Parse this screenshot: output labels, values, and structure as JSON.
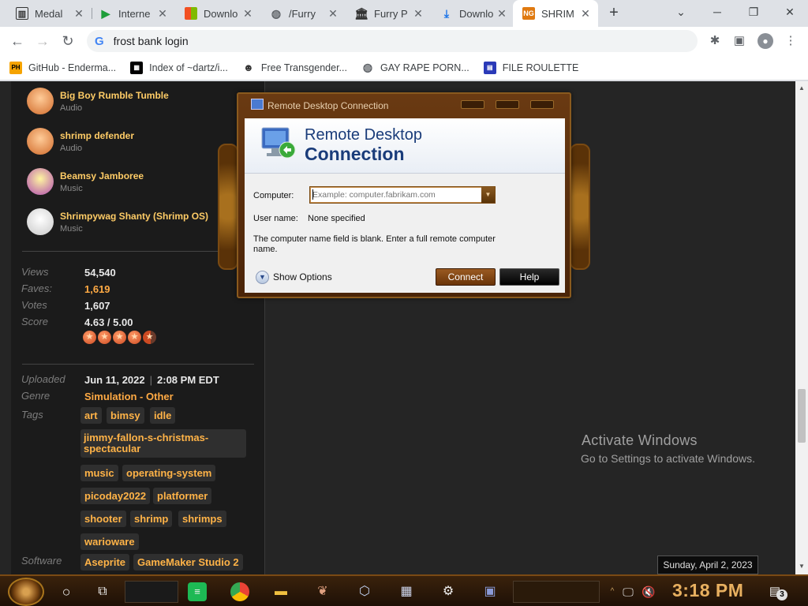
{
  "tabs": [
    {
      "title": "Medal",
      "icon": "medal-icon"
    },
    {
      "title": "Interne",
      "icon": "play-icon"
    },
    {
      "title": "Downlo",
      "icon": "windows-icon"
    },
    {
      "title": "/Furry",
      "icon": "globe-icon"
    },
    {
      "title": "Furry P",
      "icon": "archive-icon"
    },
    {
      "title": "Downlo",
      "icon": "download-icon"
    },
    {
      "title": "SHRIM",
      "icon": "newgrounds-icon"
    }
  ],
  "address_bar": {
    "value": "frost bank login"
  },
  "bookmarks": [
    {
      "label": "GitHub - Enderma...",
      "icon": "ph-icon"
    },
    {
      "label": "Index of ~dartz/i...",
      "icon": "qr-icon"
    },
    {
      "label": "Free Transgender...",
      "icon": "mask-icon"
    },
    {
      "label": "GAY RAPE PORN...",
      "icon": "globe-icon"
    },
    {
      "label": "FILE ROULETTE",
      "icon": "file-icon"
    }
  ],
  "related": [
    {
      "title": "Big Boy Rumble Tumble",
      "category": "Audio"
    },
    {
      "title": "shrimp defender",
      "category": "Audio"
    },
    {
      "title": "Beamsy Jamboree",
      "category": "Music"
    },
    {
      "title": "Shrimpywag Shanty (Shrimp OS)",
      "category": "Music"
    }
  ],
  "stats": {
    "views_label": "Views",
    "views": "54,540",
    "faves_label": "Faves:",
    "faves": "1,619",
    "votes_label": "Votes",
    "votes": "1,607",
    "score_label": "Score",
    "score": "4.63 / 5.00",
    "rating_stars": 4.63
  },
  "info": {
    "uploaded_label": "Uploaded",
    "uploaded_date": "Jun 11, 2022",
    "uploaded_time": "2:08 PM EDT",
    "genre_label": "Genre",
    "genre": "Simulation - Other",
    "tags_label": "Tags",
    "tags": [
      "art",
      "bimsy",
      "idle",
      "jimmy-fallon-s-christmas-spectacular",
      "music",
      "operating-system",
      "picoday2022",
      "platformer",
      "shooter",
      "shrimp",
      "shrimps",
      "warioware"
    ],
    "software_label": "Software",
    "software": [
      "Aseprite",
      "GameMaker Studio 2"
    ]
  },
  "dialog": {
    "title": "Remote Desktop Connection",
    "header_line1": "Remote Desktop",
    "header_line2": "Connection",
    "computer_label": "Computer:",
    "computer_placeholder": "Example: computer.fabrikam.com",
    "username_label": "User name:",
    "username_value": "None specified",
    "message": "The computer name field is blank. Enter a full remote computer name.",
    "show_options": "Show Options",
    "connect": "Connect",
    "help": "Help"
  },
  "watermark": {
    "line1": "Activate Windows",
    "line2": "Go to Settings to activate Windows."
  },
  "taskbar": {
    "clock": "3:18 PM",
    "date_tooltip": "Sunday, April 2, 2023",
    "notification_count": "3"
  }
}
